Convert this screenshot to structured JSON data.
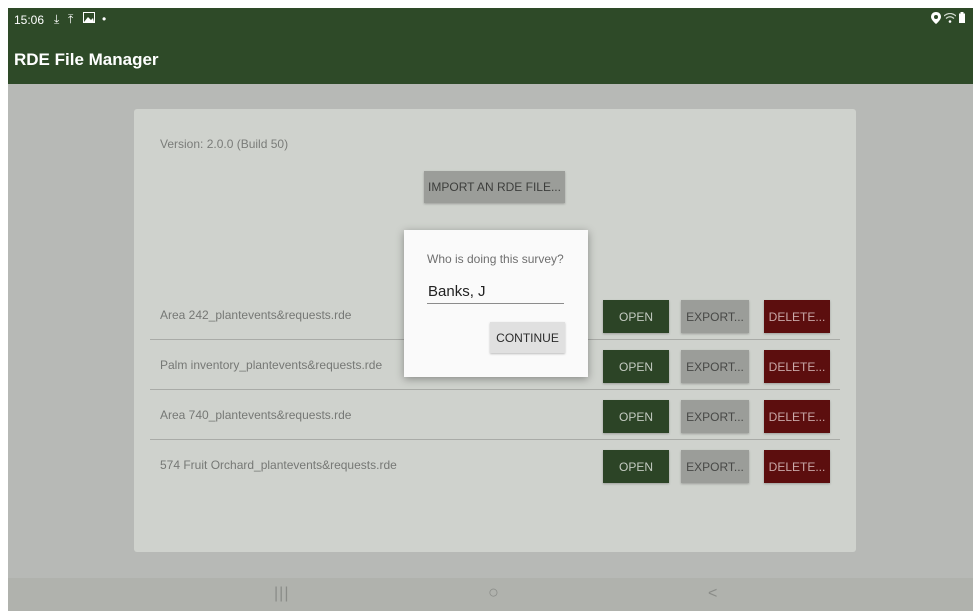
{
  "status_bar": {
    "time": "15:06",
    "left_icons": [
      "download-icon",
      "upload-icon",
      "image-icon",
      "dot-icon"
    ],
    "right_icons": [
      "location-icon",
      "wifi-icon",
      "battery-icon"
    ]
  },
  "app_bar": {
    "title": "RDE File Manager",
    "color": "#2e4a28"
  },
  "main": {
    "version_text": "Version: 2.0.0 (Build 50)",
    "import_label": "IMPORT AN RDE FILE...",
    "files": [
      {
        "name": "Area 242_plantevents&requests.rde",
        "open": "OPEN",
        "export": "EXPORT...",
        "delete": "DELETE..."
      },
      {
        "name": "Palm inventory_plantevents&requests.rde",
        "open": "OPEN",
        "export": "EXPORT...",
        "delete": "DELETE..."
      },
      {
        "name": "Area 740_plantevents&requests.rde",
        "open": "OPEN",
        "export": "EXPORT...",
        "delete": "DELETE..."
      },
      {
        "name": "574 Fruit Orchard_plantevents&requests.rde",
        "open": "OPEN",
        "export": "EXPORT...",
        "delete": "DELETE..."
      }
    ]
  },
  "dialog": {
    "title": "Who is doing this survey?",
    "input_value": "Banks, J",
    "continue_label": "CONTINUE"
  },
  "nav_bar": {
    "recents_glyph": "|||",
    "home_glyph": "○",
    "back_glyph": "<"
  },
  "colors": {
    "open": "#2c4426",
    "export": "#9b9d99",
    "delete": "#5c0e0e"
  }
}
